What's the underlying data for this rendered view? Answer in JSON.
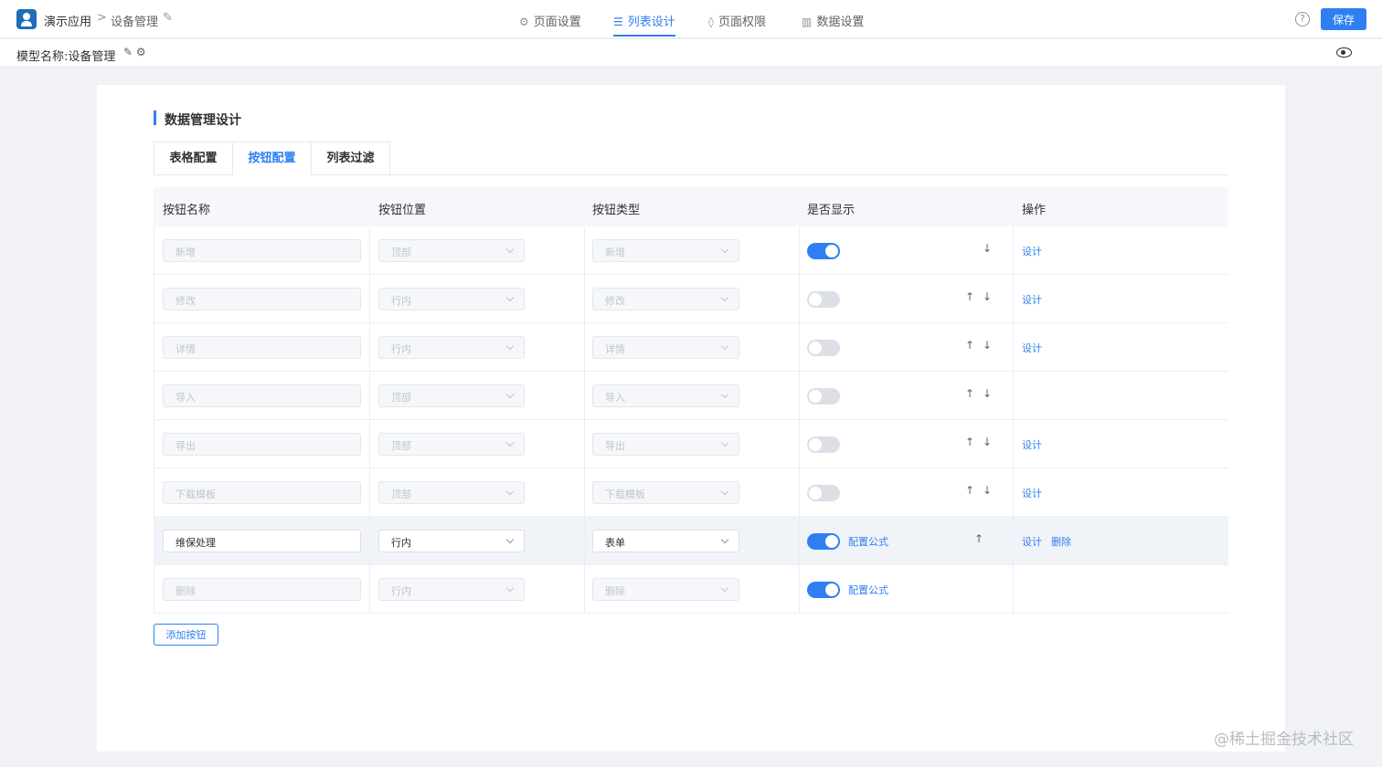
{
  "header": {
    "app_name": "演示应用",
    "breadcrumb_sep": ">",
    "current_page": "设备管理",
    "nav_tabs": [
      {
        "label": "页面设置",
        "icon": "gear-icon",
        "active": false
      },
      {
        "label": "列表设计",
        "icon": "list-icon",
        "active": true
      },
      {
        "label": "页面权限",
        "icon": "lock-icon",
        "active": false
      },
      {
        "label": "数据设置",
        "icon": "bar-chart-icon",
        "active": false
      }
    ],
    "help_glyph": "?",
    "save_label": "保存"
  },
  "subbar": {
    "model_label": "模型名称:设备管理"
  },
  "card": {
    "section_title": "数据管理设计",
    "tabs": [
      "表格配置",
      "按钮配置",
      "列表过滤"
    ],
    "active_tab": "按钮配置",
    "columns": [
      "按钮名称",
      "按钮位置",
      "按钮类型",
      "是否显示",
      "操作"
    ],
    "rows": [
      {
        "name": "新增",
        "position": "顶部",
        "type": "新增",
        "show": true,
        "formula": "",
        "up": false,
        "down": true,
        "actions": [
          "设计"
        ],
        "editable": false
      },
      {
        "name": "修改",
        "position": "行内",
        "type": "修改",
        "show": false,
        "formula": "",
        "up": true,
        "down": true,
        "actions": [
          "设计"
        ],
        "editable": false
      },
      {
        "name": "详情",
        "position": "行内",
        "type": "详情",
        "show": false,
        "formula": "",
        "up": true,
        "down": true,
        "actions": [
          "设计"
        ],
        "editable": false
      },
      {
        "name": "导入",
        "position": "顶部",
        "type": "导入",
        "show": false,
        "formula": "",
        "up": true,
        "down": true,
        "actions": [],
        "editable": false
      },
      {
        "name": "导出",
        "position": "顶部",
        "type": "导出",
        "show": false,
        "formula": "",
        "up": true,
        "down": true,
        "actions": [
          "设计"
        ],
        "editable": false
      },
      {
        "name": "下载模板",
        "position": "顶部",
        "type": "下载模板",
        "show": false,
        "formula": "",
        "up": true,
        "down": true,
        "actions": [
          "设计"
        ],
        "editable": false
      },
      {
        "name": "维保处理",
        "position": "行内",
        "type": "表单",
        "show": true,
        "formula": "配置公式",
        "up": true,
        "down": false,
        "actions": [
          "设计",
          "删除"
        ],
        "editable": true
      },
      {
        "name": "删除",
        "position": "行内",
        "type": "删除",
        "show": true,
        "formula": "配置公式",
        "up": false,
        "down": false,
        "actions": [],
        "editable": false
      }
    ],
    "add_button_label": "添加按钮"
  },
  "watermark": "@稀土掘金技术社区",
  "colors": {
    "accent": "#2f7ff2",
    "background": "#f0f2f5"
  }
}
